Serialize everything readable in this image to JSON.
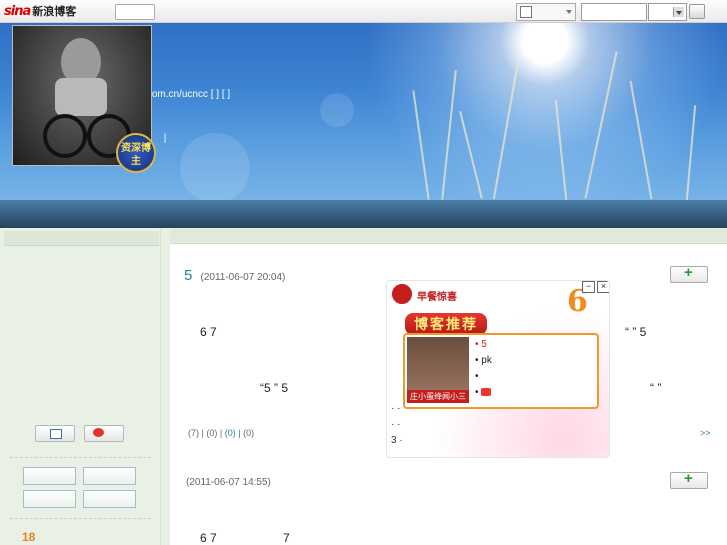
{
  "topbar": {
    "logo_mark": "sina",
    "logo_text": "新浪博客",
    "nav_button_label": "",
    "write_button_label": "",
    "search_value": "",
    "search_select_value": ""
  },
  "banner": {
    "blog_title": "",
    "blog_url": "http://blog.sina.com.cn/ucncc",
    "url_suffix": "[ ] [ ]",
    "nav_separators": "| | |"
  },
  "sidebar": {
    "medal_text": "资深博主",
    "rank_number": "18",
    "links": [
      "",
      "",
      "",
      ""
    ]
  },
  "posts": [
    {
      "title": "",
      "title_number": "5",
      "date": "(2011-06-07 20:04)",
      "line1_left": "6 7",
      "line1_right": "“ ” 5",
      "line2_left": "“5 ” 5",
      "line2_right": "“ ”",
      "meta_read": "(7)",
      "meta_sep1": "|",
      "meta_comment": "(0)",
      "meta_sep2": "|",
      "meta_repost": "(0)",
      "meta_sep3": "|",
      "meta_fav": "(0)",
      "more": ">>"
    },
    {
      "title": "",
      "date": "(2011-06-07 14:55)",
      "line1_left": "6 7",
      "line1_right": "7"
    }
  ],
  "ad": {
    "header_text": "早餐惊喜",
    "banner_title": "博客推荐",
    "big_number": "6",
    "photo_caption": "庄小蛋绛闻小三",
    "items": [
      {
        "text": "5",
        "highlight": true
      },
      {
        "text": "pk",
        "highlight": false
      },
      {
        "text": "",
        "highlight": false
      },
      {
        "text": "",
        "highlight": false
      }
    ],
    "links": [
      "· ·",
      "· ·",
      "3 ·"
    ],
    "min_label": "−",
    "close_label": "×"
  },
  "colors": {
    "title_teal": "#1f8a8a",
    "ad_red": "#c41e1e",
    "accent_orange": "#f08c1a"
  }
}
